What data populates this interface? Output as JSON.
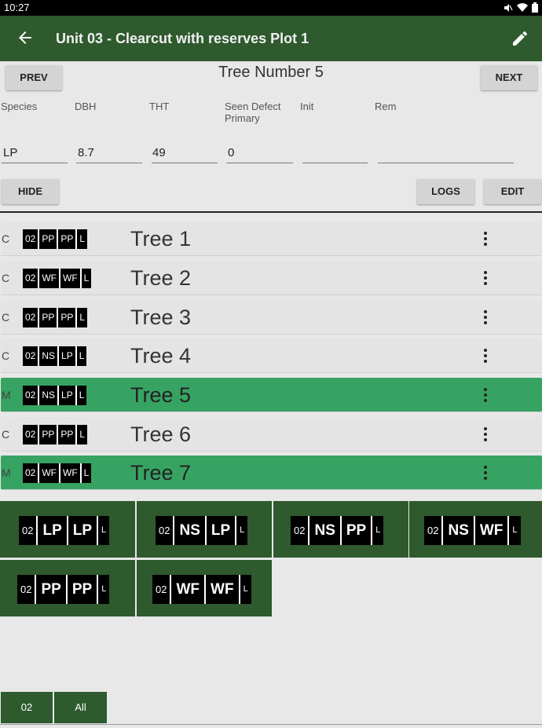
{
  "status_bar": {
    "time": "10:27",
    "icons": [
      "mute-icon",
      "wifi-icon",
      "battery-icon"
    ]
  },
  "app_bar": {
    "title": "Unit 03 - Clearcut with reserves Plot 1",
    "back_icon": "arrow-back-icon",
    "edit_icon": "pencil-icon"
  },
  "navigation": {
    "prev_label": "PREV",
    "next_label": "NEXT",
    "tree_number": "Tree Number 5"
  },
  "fields": {
    "species": {
      "label": "Species",
      "value": "LP"
    },
    "dbh": {
      "label": "DBH",
      "value": "8.7"
    },
    "tht": {
      "label": "THT",
      "value": "49"
    },
    "defect": {
      "label": "Seen Defect Primary",
      "value": "0"
    },
    "init": {
      "label": "Init",
      "value": ""
    },
    "rem": {
      "label": "Rem",
      "value": ""
    }
  },
  "actions": {
    "hide_label": "HIDE",
    "logs_label": "LOGS",
    "edit_label": "EDIT"
  },
  "trees": [
    {
      "status": "C",
      "codes": [
        "02",
        "PP",
        "PP",
        "L"
      ],
      "name": "Tree 1",
      "selected": false
    },
    {
      "status": "C",
      "codes": [
        "02",
        "WF",
        "WF",
        "L"
      ],
      "name": "Tree 2",
      "selected": false
    },
    {
      "status": "C",
      "codes": [
        "02",
        "PP",
        "PP",
        "L"
      ],
      "name": "Tree 3",
      "selected": false
    },
    {
      "status": "C",
      "codes": [
        "02",
        "NS",
        "LP",
        "L"
      ],
      "name": "Tree 4",
      "selected": false
    },
    {
      "status": "M",
      "codes": [
        "02",
        "NS",
        "LP",
        "L"
      ],
      "name": "Tree 5",
      "selected": true
    },
    {
      "status": "C",
      "codes": [
        "02",
        "PP",
        "PP",
        "L"
      ],
      "name": "Tree 6",
      "selected": false
    },
    {
      "status": "M",
      "codes": [
        "02",
        "WF",
        "WF",
        "L"
      ],
      "name": "Tree 7",
      "selected": true
    }
  ],
  "species_tiles": [
    {
      "codes": [
        "02",
        "LP",
        "LP",
        "L"
      ]
    },
    {
      "codes": [
        "02",
        "NS",
        "LP",
        "L"
      ]
    },
    {
      "codes": [
        "02",
        "NS",
        "PP",
        "L"
      ]
    },
    {
      "codes": [
        "02",
        "NS",
        "WF",
        "L"
      ]
    },
    {
      "codes": [
        "02",
        "PP",
        "PP",
        "L"
      ]
    },
    {
      "codes": [
        "02",
        "WF",
        "WF",
        "L"
      ]
    }
  ],
  "bottom_tabs": [
    "02",
    "All"
  ],
  "colors": {
    "primary_dark": "#2e5a2e",
    "selected_row": "#37a363",
    "background": "#e8e8e8"
  }
}
